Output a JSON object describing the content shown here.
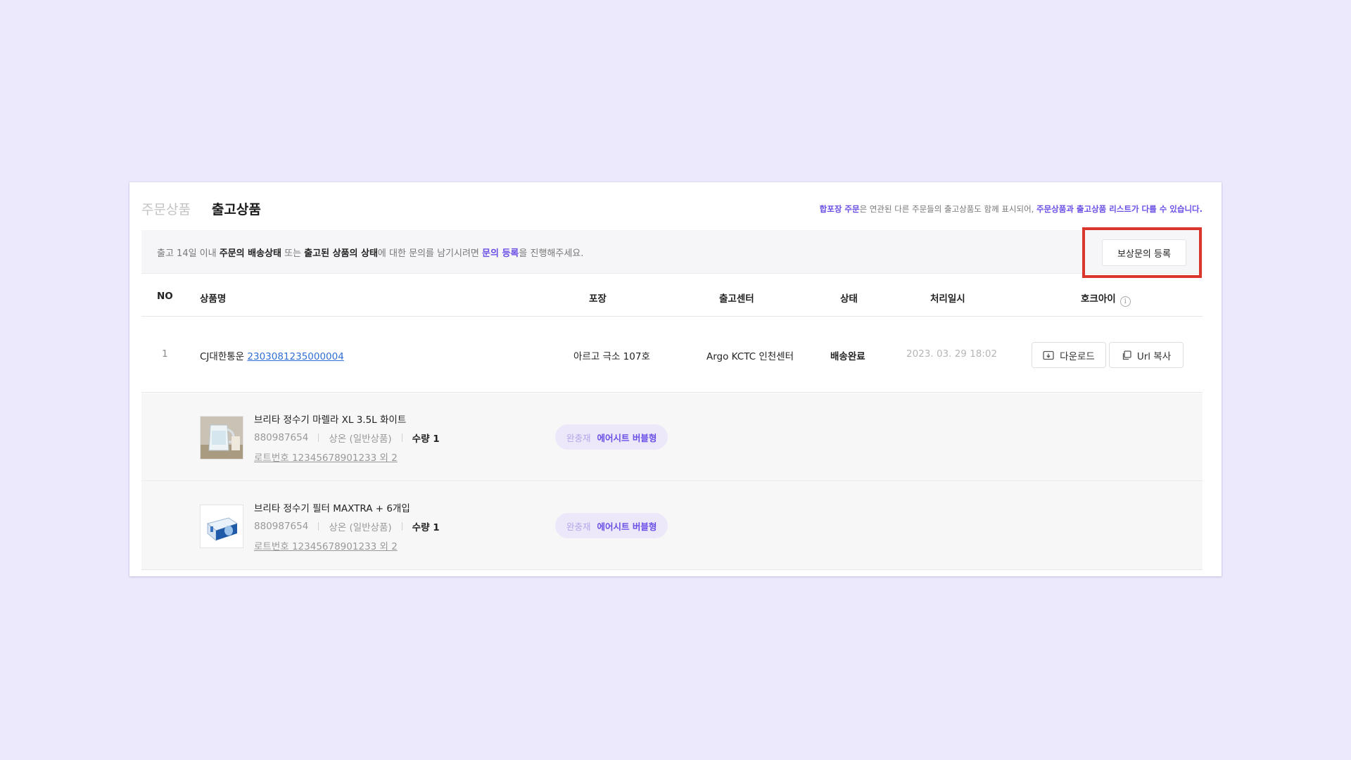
{
  "tabs": [
    {
      "label": "주문상품",
      "active": false
    },
    {
      "label": "출고상품",
      "active": true
    }
  ],
  "head_note": {
    "part1": "합포장 주문",
    "part2": "은 연관된 다른 주문들의 출고상품도 함께 표시되어, ",
    "part3": "주문상품과 출고상품 리스트가 다를 수 있습니다."
  },
  "info_bar": {
    "t1": "출고 14일 이내 ",
    "b1": "주문의 배송상태",
    "t2": " 또는 ",
    "b2": "출고된 상품의 상태",
    "t3": "에 대한 문의를 남기시려면 ",
    "link": "문의 등록",
    "t4": "을 진행해주세요."
  },
  "claim_button": "보상문의 등록",
  "columns": {
    "no": "NO",
    "product": "상품명",
    "packaging": "포장",
    "center": "출고센터",
    "status": "상태",
    "processed": "처리일시",
    "waybill": "호크아이"
  },
  "row": {
    "no": "1",
    "carrier": "CJ대한통운 ",
    "tracking": "2303081235000004",
    "packaging": "아르고 극소 107호",
    "center": "Argo KCTC 인천센터",
    "status": "배송완료",
    "date": "2023. 03. 29 18:02",
    "download": "다운로드",
    "copy_url": "Url 복사"
  },
  "items": [
    {
      "name": "브리타 정수기 마렐라 XL 3.5L 화이트",
      "code": "880987654",
      "storage": "상온 (일반상품)",
      "qty": "수량 1",
      "lot": "로트번호 12345678901233 외 2",
      "cushion_label": "완충재",
      "cushion_value": "에어시트 버블형"
    },
    {
      "name": "브리타 정수기 필터 MAXTRA + 6개입",
      "code": "880987654",
      "storage": "상온 (일반상품)",
      "qty": "수량 1",
      "lot": "로트번호 12345678901233 외 2",
      "cushion_label": "완충재",
      "cushion_value": "에어시트 버블형"
    }
  ],
  "colors": {
    "accent": "#6b4ee6",
    "link_blue": "#2f6fd6",
    "highlight_red": "#d9372c",
    "page_bg": "#ece9fc"
  }
}
